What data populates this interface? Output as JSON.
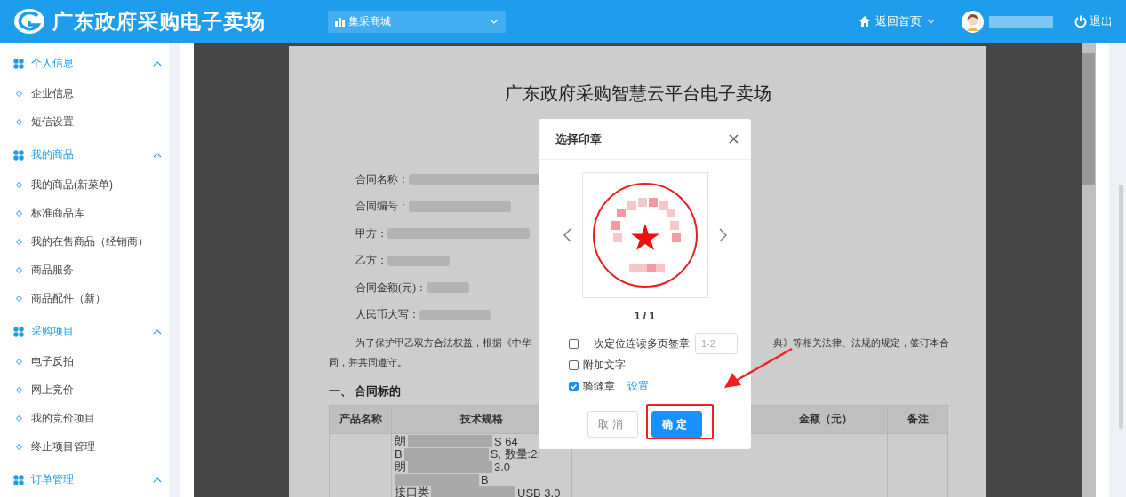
{
  "header": {
    "title": "广东政府采购电子卖场",
    "mall_select": {
      "value": "集采商城"
    },
    "home_link": "返回首页",
    "logout": "退出"
  },
  "sidebar": {
    "groups": [
      {
        "label": "个人信息",
        "expanded": true,
        "items": [
          "企业信息",
          "短信设置"
        ]
      },
      {
        "label": "我的商品",
        "expanded": true,
        "items": [
          "我的商品(新菜单)",
          "标准商品库",
          "我的在售商品（经销商）",
          "商品服务",
          "商品配件（新）"
        ]
      },
      {
        "label": "采购项目",
        "expanded": true,
        "items": [
          "电子反拍",
          "网上竞价",
          "我的竞价项目",
          "终止项目管理"
        ]
      },
      {
        "label": "订单管理",
        "expanded": true
      }
    ]
  },
  "document": {
    "title": "广东政府采购智慧云平台电子卖场",
    "fields": [
      {
        "label": "合同名称："
      },
      {
        "label": "合同编号："
      },
      {
        "label": "甲方："
      },
      {
        "label": "乙方："
      },
      {
        "label": "合同金额(元)："
      },
      {
        "label": "人民币大写："
      }
    ],
    "paragraph": {
      "start": "为了保护甲乙双方合法权益，根据《中华",
      "end": "典》等相关法律、法规的规定，签订本合",
      "continuation": "同，并共同遵守。"
    },
    "section_heading": "一、 合同标的",
    "table": {
      "columns": [
        "产品名称",
        "技术规格",
        "金额（元）",
        "备注"
      ],
      "spec_lines": [
        {
          "start": "朗",
          "end": "S 64"
        },
        {
          "start": "B",
          "end": "S, 数量:2;"
        },
        {
          "start": "朗",
          "end": "3.0"
        },
        {
          "end": "B"
        },
        {
          "start": "接口类",
          "end": "USB 3.0"
        }
      ]
    }
  },
  "modal": {
    "title": "选择印章",
    "pager": "1 / 1",
    "options": [
      {
        "label": "一次定位连读多页签章",
        "checked": false,
        "range_field": {
          "placeholder": "1-2"
        }
      },
      {
        "label": "附加文字",
        "checked": false
      },
      {
        "label": "骑缝章",
        "checked": true,
        "link": "设置"
      }
    ],
    "buttons": [
      {
        "label": "取消",
        "kind": "secondary"
      },
      {
        "label": "确定",
        "kind": "primary"
      }
    ]
  }
}
